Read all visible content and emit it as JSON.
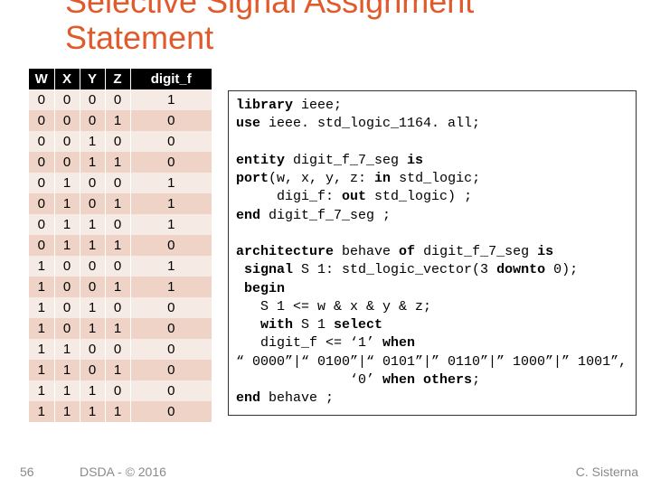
{
  "title_line1": "Selective Signal Assignment",
  "title_line2": "Statement",
  "page_number": "56",
  "footer_left": "DSDA - © 2016",
  "footer_right": "C. Sisterna",
  "table": {
    "headers": [
      "W",
      "X",
      "Y",
      "Z",
      "digit_f"
    ],
    "rows": [
      [
        "0",
        "0",
        "0",
        "0",
        "1"
      ],
      [
        "0",
        "0",
        "0",
        "1",
        "0"
      ],
      [
        "0",
        "0",
        "1",
        "0",
        "0"
      ],
      [
        "0",
        "0",
        "1",
        "1",
        "0"
      ],
      [
        "0",
        "1",
        "0",
        "0",
        "1"
      ],
      [
        "0",
        "1",
        "0",
        "1",
        "1"
      ],
      [
        "0",
        "1",
        "1",
        "0",
        "1"
      ],
      [
        "0",
        "1",
        "1",
        "1",
        "0"
      ],
      [
        "1",
        "0",
        "0",
        "0",
        "1"
      ],
      [
        "1",
        "0",
        "0",
        "1",
        "1"
      ],
      [
        "1",
        "0",
        "1",
        "0",
        "0"
      ],
      [
        "1",
        "0",
        "1",
        "1",
        "0"
      ],
      [
        "1",
        "1",
        "0",
        "0",
        "0"
      ],
      [
        "1",
        "1",
        "0",
        "1",
        "0"
      ],
      [
        "1",
        "1",
        "1",
        "0",
        "0"
      ],
      [
        "1",
        "1",
        "1",
        "1",
        "0"
      ]
    ]
  },
  "code": {
    "l01a": "library",
    "l01b": " ieee;",
    "l02a": "use",
    "l02b": " ieee. std_logic_1164. all;",
    "gap1": "",
    "l03a": "entity",
    "l03b": " digit_f_7_seg ",
    "l03c": "is",
    "l04a": "port",
    "l04b": "(w, x, y, z: ",
    "l04c": "in",
    "l04d": " std_logic;",
    "l05a": "     digi_f: ",
    "l05b": "out",
    "l05c": " std_logic) ;",
    "l06a": "end",
    "l06b": " digit_f_7_seg ;",
    "gap2": "",
    "l07a": "architecture",
    "l07b": " behave ",
    "l07c": "of",
    "l07d": " digit_f_7_seg ",
    "l07e": "is",
    "l08a": " signal",
    "l08b": " S 1: std_logic_vector(3 ",
    "l08c": "downto",
    "l08d": " 0);",
    "l09a": " begin",
    "l10": "   S 1 <= w & x & y & z;",
    "l11a": "   with",
    "l11b": " S 1 ",
    "l11c": "select",
    "l12a": "   digit_f <= ‘1’ ",
    "l12b": "when",
    "l13": "“ 0000”|“ 0100”|“ 0101”|” 0110”|” 1000”|” 1001”,",
    "l14a": "              ‘0’ ",
    "l14b": "when others",
    "l14c": ";",
    "l15a": "end",
    "l15b": " behave ;"
  }
}
